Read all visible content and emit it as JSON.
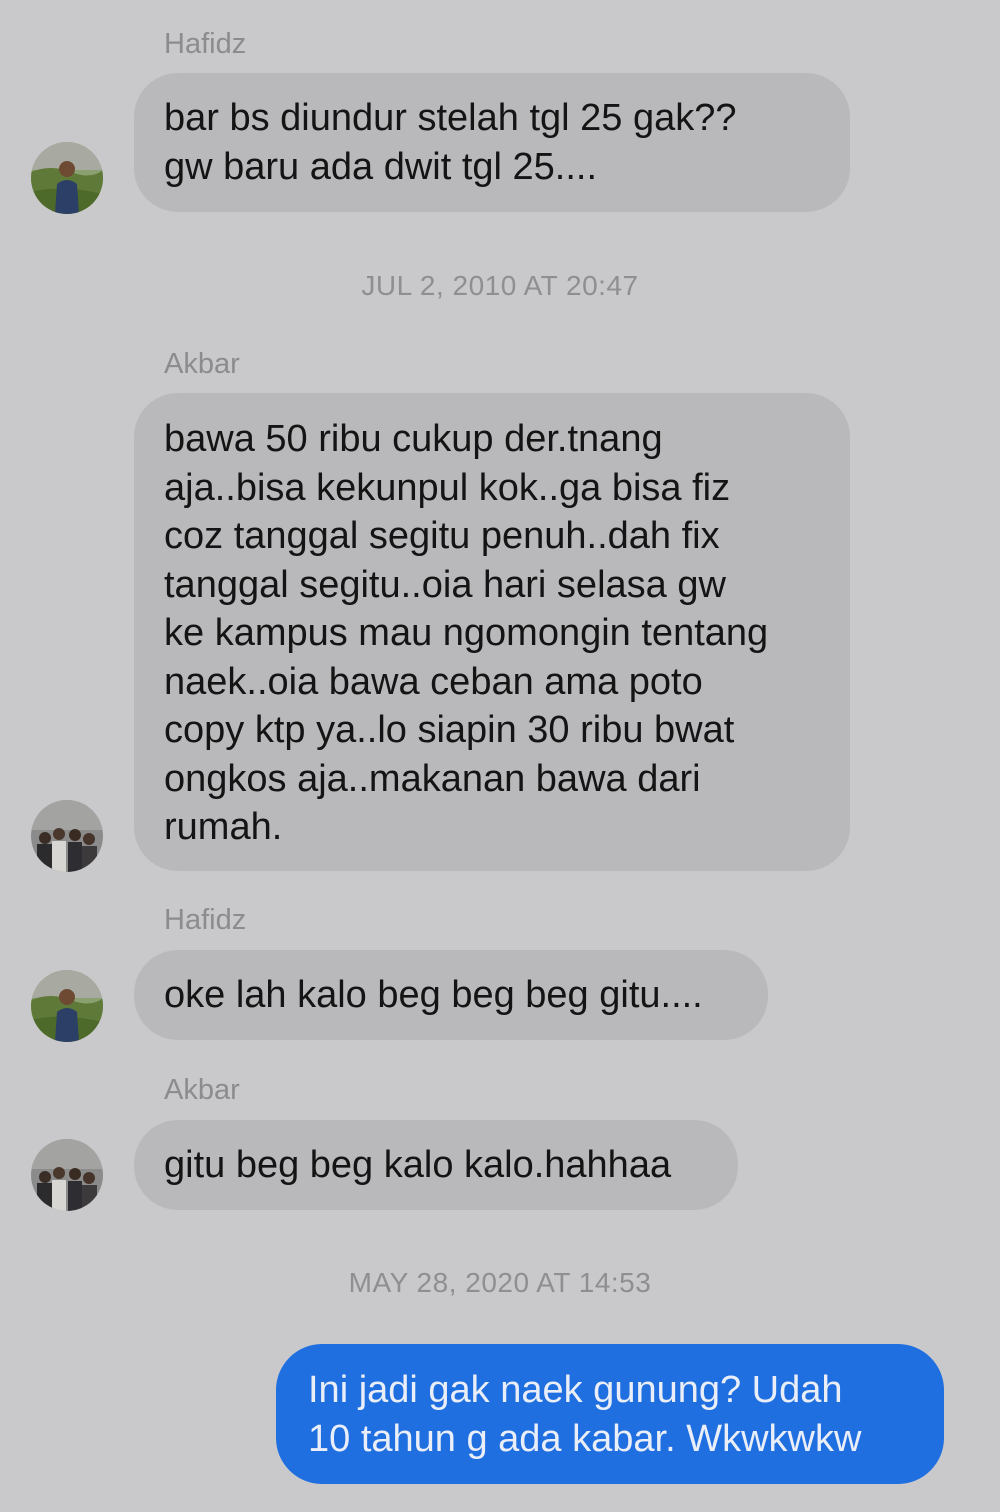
{
  "conversation": {
    "hafidz_1": {
      "sender": "Hafidz",
      "text": "bar bs diundur stelah tgl 25 gak??\ngw baru ada dwit tgl 25...."
    },
    "timestamp_1": "JUL 2, 2010 AT 20:47",
    "akbar_1": {
      "sender": "Akbar",
      "text": "bawa 50 ribu cukup der.tnang\naja..bisa kekunpul kok..ga bisa fiz\ncoz tanggal segitu penuh..dah fix\ntanggal segitu..oia hari selasa gw\nke kampus mau ngomongin tentang\nnaek..oia bawa ceban ama poto\ncopy ktp ya..lo siapin 30 ribu bwat\nongkos aja..makanan bawa dari\nrumah."
    },
    "hafidz_2": {
      "sender": "Hafidz",
      "text": "oke lah kalo beg beg beg gitu...."
    },
    "akbar_2": {
      "sender": "Akbar",
      "text": "gitu beg beg kalo kalo.hahhaa"
    },
    "timestamp_2": "MAY 28, 2020 AT 14:53",
    "outgoing_1": {
      "text": "Ini jadi gak naek gunung? Udah\n10 tahun g ada kabar. Wkwkwkw"
    }
  },
  "avatars": {
    "hafidz": "person-on-green-hill-avatar",
    "akbar": "group-photo-avatar"
  },
  "colors": {
    "background": "#c9c9cb",
    "incoming_bubble": "#b9b9bb",
    "outgoing_bubble": "#1f6fe0",
    "meta_text": "#8c8c8e"
  }
}
